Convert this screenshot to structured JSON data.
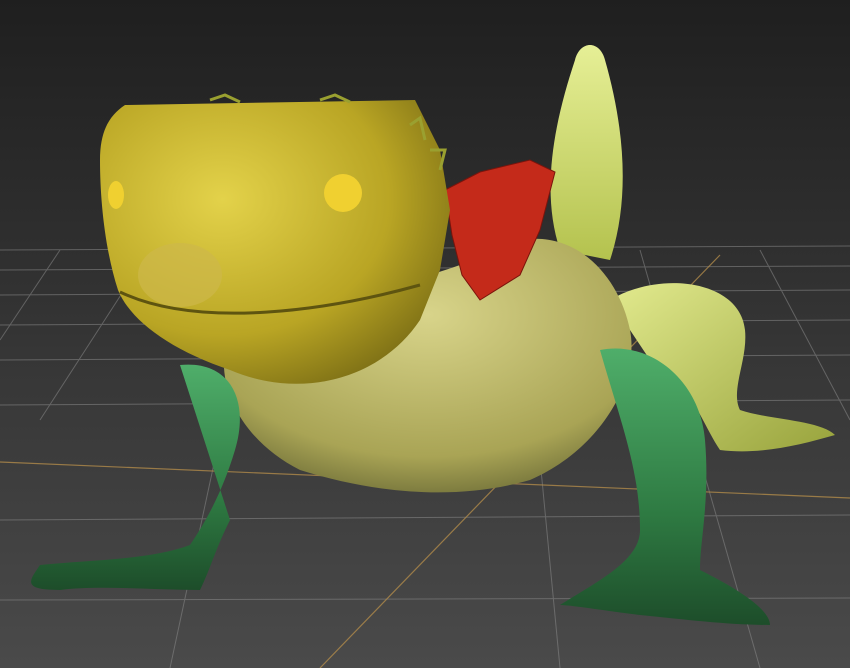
{
  "viewport": {
    "view": "perspective",
    "grid_visible": true,
    "background_color": "#2e2e2e",
    "grid_color": "#8a8a8a",
    "grid_axis_color": "#b08a4a"
  },
  "model": {
    "subject": "lizard",
    "colors": {
      "head": "#c8b52a",
      "back_tail": "#d6e07a",
      "legs": "#2f8a45",
      "selected_mesh": "#c42a1a",
      "eyes": "#f0d030"
    }
  }
}
